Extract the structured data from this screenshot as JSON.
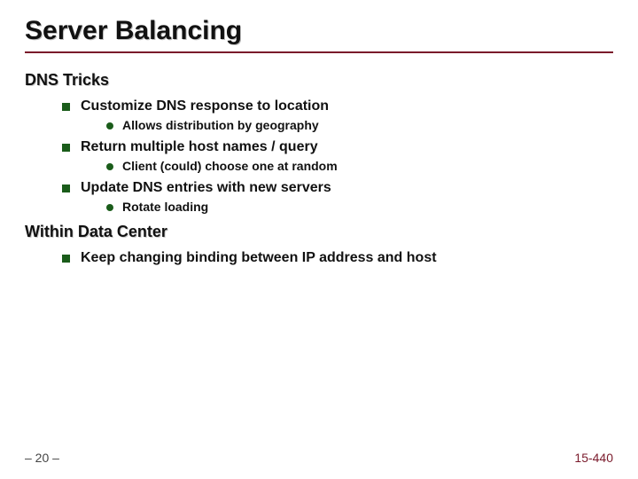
{
  "title": "Server Balancing",
  "sections": [
    {
      "heading": "DNS Tricks",
      "items": [
        {
          "text": "Customize DNS response to location",
          "sub": [
            "Allows distribution by geography"
          ]
        },
        {
          "text": "Return multiple host names / query",
          "sub": [
            "Client (could) choose one at random"
          ]
        },
        {
          "text": "Update DNS entries with new servers",
          "sub": [
            "Rotate loading"
          ]
        }
      ]
    },
    {
      "heading": "Within Data Center",
      "items": [
        {
          "text": "Keep changing binding between IP address and host",
          "sub": []
        }
      ]
    }
  ],
  "footer": {
    "left": "– 20 –",
    "right": "15-440"
  }
}
